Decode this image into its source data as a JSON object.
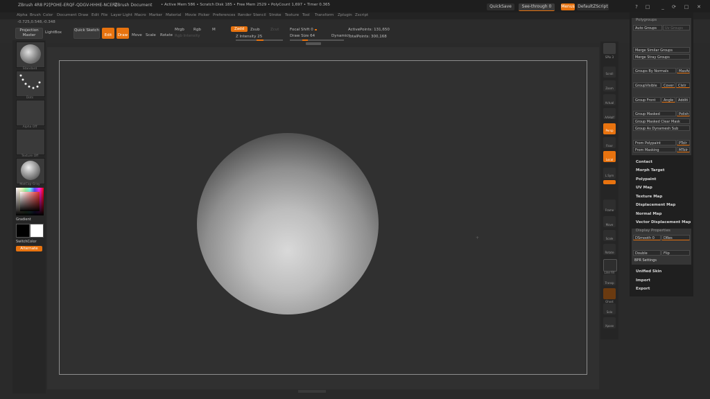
{
  "titlebar": {
    "app": "ZBrush 4R8 P2[POHE-ERQF-QDGV-HHHE-NCER]",
    "doc": "ZBrush Document",
    "stats": "• Active Mem 586 • Scratch Disk 185 • Free Mem 2529 • PolyCount 1,697 • Timer 0.365",
    "quicksave": "QuickSave",
    "seethrough": "See-through 0",
    "menus": "Menus",
    "script": "DefaultZScript",
    "win_btns": [
      "?",
      "□",
      "_",
      "⟳",
      "□",
      "✕"
    ]
  },
  "menubar": [
    "Alpha",
    "Brush",
    "Color",
    "Document",
    "Draw",
    "Edit",
    "File",
    "Layer",
    "Light",
    "Macro",
    "Marker",
    "Material",
    "Movie",
    "Picker",
    "Preferences",
    "Render",
    "Stencil",
    "Stroke",
    "Texture",
    "Tool",
    "Transform",
    "Zplugin",
    "Zscript"
  ],
  "shelf": {
    "coords": "-0.725,0.548,-0.348",
    "projection_master": "Projection Master",
    "lightbox": "LightBox",
    "quick_sketch": "Quick Sketch",
    "edit": "Edit",
    "draw": "Draw",
    "move": "Move",
    "scale": "Scale",
    "rotate": "Rotate",
    "mrgb": "Mrgb",
    "rgb": "Rgb",
    "m": "M",
    "rgb_intensity": "Rgb Intensity",
    "zadd": "Zadd",
    "zsub": "Zsub",
    "zcut": "Zcut",
    "z_intensity": "Z Intensity 25",
    "focal_shift": "Focal Shift 0",
    "draw_size": "Draw Size 64",
    "dynamic": "Dynamic",
    "active_points": "ActivePoints: 131,650",
    "total_points": "TotalPoints: 300,168"
  },
  "lefttray": {
    "labels": [
      "Standard",
      "Dots",
      "Alpha Off",
      "Texture Off",
      "MatCap Gray"
    ],
    "gradient": "Gradient",
    "switchcolor": "SwitchColor",
    "alternate": "Alternate"
  },
  "rightshelf": [
    "SPix 3",
    "Scroll",
    "Zoom",
    "Actual",
    "AAHalf",
    "Persp",
    "Floor",
    "Local",
    "L.Sym",
    "Frame",
    "Move",
    "Scale",
    "Rotate",
    "Line Fill",
    "Transp",
    "Ghost",
    "Solo",
    "Xpose"
  ],
  "palette": {
    "polygroups_header": "Polygroups",
    "auto_groups": "Auto Groups",
    "uv_groups": "Uv Groups",
    "merge_similar": "Merge Similar Groups",
    "merge_stray": "Merge Stray Groups",
    "groups_by_normals": "Groups By Normals",
    "maxangle": "MaxAn",
    "group_visible": "GroupVisible",
    "coverage": "Cover",
    "clustering": "Clstr",
    "group_front": "Group Front",
    "angle": "Angle",
    "additive": "Additi",
    "group_masked": "Group Masked",
    "polish": "Polish",
    "group_masked_clear": "Group Masked Clear Mask",
    "group_as_dynamesh": "Group As Dynamesh Sub",
    "from_polypaint": "From Polypaint",
    "ptolerance": "PTolr",
    "from_masking": "From Masking",
    "mtolerance": "MTolr",
    "sections": [
      "Contact",
      "Morph Target",
      "Polypaint",
      "UV Map",
      "Texture Map",
      "Displacement Map",
      "Normal Map",
      "Vector Displacement Map"
    ],
    "display_header": "Display Properties",
    "dsmooth": "DSmooth 0",
    "dres": "DRes",
    "double": "Double",
    "flip": "Flip",
    "bpr_settings": "BPR Settings",
    "sections2": [
      "Unified Skin",
      "Import",
      "Export"
    ]
  },
  "colors": {
    "accent": "#e8730f",
    "background": "#2a2a2a",
    "canvas": "#303030"
  }
}
